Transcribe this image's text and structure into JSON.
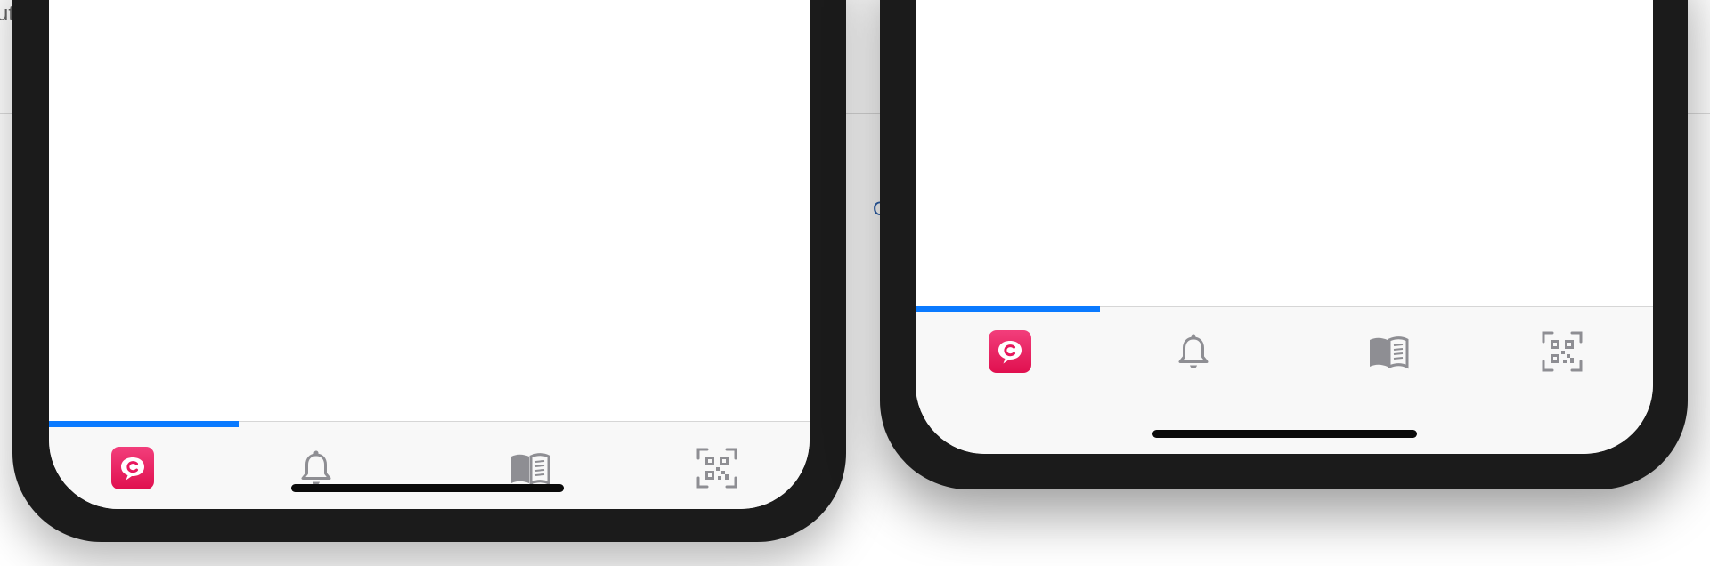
{
  "background": {
    "left_text_fragment": "ut",
    "mid_text_fragment": "C"
  },
  "colors": {
    "frame": "#1b1b1b",
    "accent_blue": "#0a7aff",
    "app_pink": "#e8175d",
    "icon_gray": "#8e8e93",
    "tabbar_bg": "#f8f8f8"
  },
  "phones": [
    {
      "name": "left-phone",
      "tabs": [
        {
          "name": "home",
          "icon": "app-logo-icon",
          "selected": true
        },
        {
          "name": "notifications",
          "icon": "bell-icon",
          "selected": false
        },
        {
          "name": "guide",
          "icon": "book-icon",
          "selected": false
        },
        {
          "name": "scan",
          "icon": "qr-code-icon",
          "selected": false
        }
      ],
      "progress_fraction": 0.25
    },
    {
      "name": "right-phone",
      "tabs": [
        {
          "name": "home",
          "icon": "app-logo-icon",
          "selected": true
        },
        {
          "name": "notifications",
          "icon": "bell-icon",
          "selected": false
        },
        {
          "name": "guide",
          "icon": "book-icon",
          "selected": false
        },
        {
          "name": "scan",
          "icon": "qr-code-icon",
          "selected": false
        }
      ],
      "progress_fraction": 0.25
    }
  ]
}
